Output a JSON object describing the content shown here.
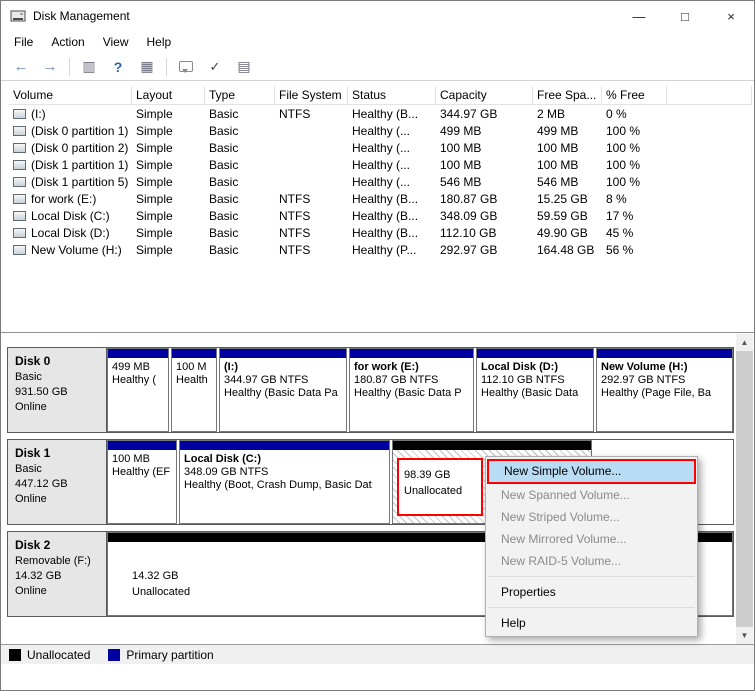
{
  "window": {
    "title": "Disk Management",
    "minimize": "—",
    "maximize": "□",
    "close": "×"
  },
  "menu_bar": {
    "items": [
      "File",
      "Action",
      "View",
      "Help"
    ]
  },
  "toolbar": {
    "icons": [
      "back",
      "forward",
      "show-console-tree",
      "help",
      "details-view",
      "comment",
      "check",
      "list-view"
    ]
  },
  "volume_table": {
    "columns": [
      "Volume",
      "Layout",
      "Type",
      "File System",
      "Status",
      "Capacity",
      "Free Spa...",
      "% Free"
    ],
    "rows": [
      {
        "volume": "(I:)",
        "layout": "Simple",
        "type": "Basic",
        "file_system": "NTFS",
        "status": "Healthy (B...",
        "capacity": "344.97 GB",
        "free_space": "2 MB",
        "pct_free": "0 %"
      },
      {
        "volume": "(Disk 0 partition 1)",
        "layout": "Simple",
        "type": "Basic",
        "file_system": "",
        "status": "Healthy (...",
        "capacity": "499 MB",
        "free_space": "499 MB",
        "pct_free": "100 %"
      },
      {
        "volume": "(Disk 0 partition 2)",
        "layout": "Simple",
        "type": "Basic",
        "file_system": "",
        "status": "Healthy (...",
        "capacity": "100 MB",
        "free_space": "100 MB",
        "pct_free": "100 %"
      },
      {
        "volume": "(Disk 1 partition 1)",
        "layout": "Simple",
        "type": "Basic",
        "file_system": "",
        "status": "Healthy (...",
        "capacity": "100 MB",
        "free_space": "100 MB",
        "pct_free": "100 %"
      },
      {
        "volume": "(Disk 1 partition 5)",
        "layout": "Simple",
        "type": "Basic",
        "file_system": "",
        "status": "Healthy (...",
        "capacity": "546 MB",
        "free_space": "546 MB",
        "pct_free": "100 %"
      },
      {
        "volume": "for work (E:)",
        "layout": "Simple",
        "type": "Basic",
        "file_system": "NTFS",
        "status": "Healthy (B...",
        "capacity": "180.87 GB",
        "free_space": "15.25 GB",
        "pct_free": "8 %"
      },
      {
        "volume": "Local Disk (C:)",
        "layout": "Simple",
        "type": "Basic",
        "file_system": "NTFS",
        "status": "Healthy (B...",
        "capacity": "348.09 GB",
        "free_space": "59.59 GB",
        "pct_free": "17 %"
      },
      {
        "volume": "Local Disk (D:)",
        "layout": "Simple",
        "type": "Basic",
        "file_system": "NTFS",
        "status": "Healthy (B...",
        "capacity": "112.10 GB",
        "free_space": "49.90 GB",
        "pct_free": "45 %"
      },
      {
        "volume": "New Volume (H:)",
        "layout": "Simple",
        "type": "Basic",
        "file_system": "NTFS",
        "status": "Healthy (P...",
        "capacity": "292.97 GB",
        "free_space": "164.48 GB",
        "pct_free": "56 %"
      }
    ]
  },
  "disks": [
    {
      "name": "Disk 0",
      "kind": "Basic",
      "size": "931.50 GB",
      "status": "Online",
      "partitions": [
        {
          "line1": "499 MB",
          "line2": "Healthy (",
          "line3": ""
        },
        {
          "line1": "100 M",
          "line2": "Health",
          "line3": ""
        },
        {
          "line1": "(I:)",
          "line2": "344.97 GB NTFS",
          "line3": "Healthy (Basic Data Pa"
        },
        {
          "line1": "for work  (E:)",
          "line2": "180.87 GB NTFS",
          "line3": "Healthy (Basic Data P"
        },
        {
          "line1": "Local Disk (D:)",
          "line2": "112.10 GB NTFS",
          "line3": "Healthy (Basic Data"
        },
        {
          "line1": "New Volume  (H:)",
          "line2": "292.97 GB NTFS",
          "line3": "Healthy (Page File, Ba"
        }
      ]
    },
    {
      "name": "Disk 1",
      "kind": "Basic",
      "size": "447.12 GB",
      "status": "Online",
      "partitions": [
        {
          "line1": "100 MB",
          "line2": "Healthy (EF",
          "line3": ""
        },
        {
          "line1": "Local Disk (C:)",
          "line2": "348.09 GB NTFS",
          "line3": "Healthy (Boot, Crash Dump, Basic Dat"
        },
        {
          "line1": "98.39 GB",
          "line2": "Unallocated",
          "line3": ""
        }
      ]
    },
    {
      "name": "Disk 2",
      "kind": "Removable (F:)",
      "size": "14.32 GB",
      "status": "Online",
      "partitions": [
        {
          "line1": "14.32 GB",
          "line2": "Unallocated",
          "line3": ""
        }
      ]
    }
  ],
  "context_menu": {
    "items": [
      {
        "label": "New Simple Volume...",
        "state": "highlighted"
      },
      {
        "label": "New Spanned Volume...",
        "state": "disabled"
      },
      {
        "label": "New Striped Volume...",
        "state": "disabled"
      },
      {
        "label": "New Mirrored Volume...",
        "state": "disabled"
      },
      {
        "label": "New RAID-5 Volume...",
        "state": "disabled"
      },
      {
        "label": "Properties",
        "state": "enabled"
      },
      {
        "label": "Help",
        "state": "enabled"
      }
    ]
  },
  "legend": {
    "unallocated": "Unallocated",
    "primary": "Primary partition"
  },
  "colors": {
    "primary_partition": "#0000A0",
    "unallocated": "#000000",
    "menu_highlight": "#B9DCF5",
    "annotation": "#FF0000",
    "disk_info_bg": "#E6E6E6"
  }
}
